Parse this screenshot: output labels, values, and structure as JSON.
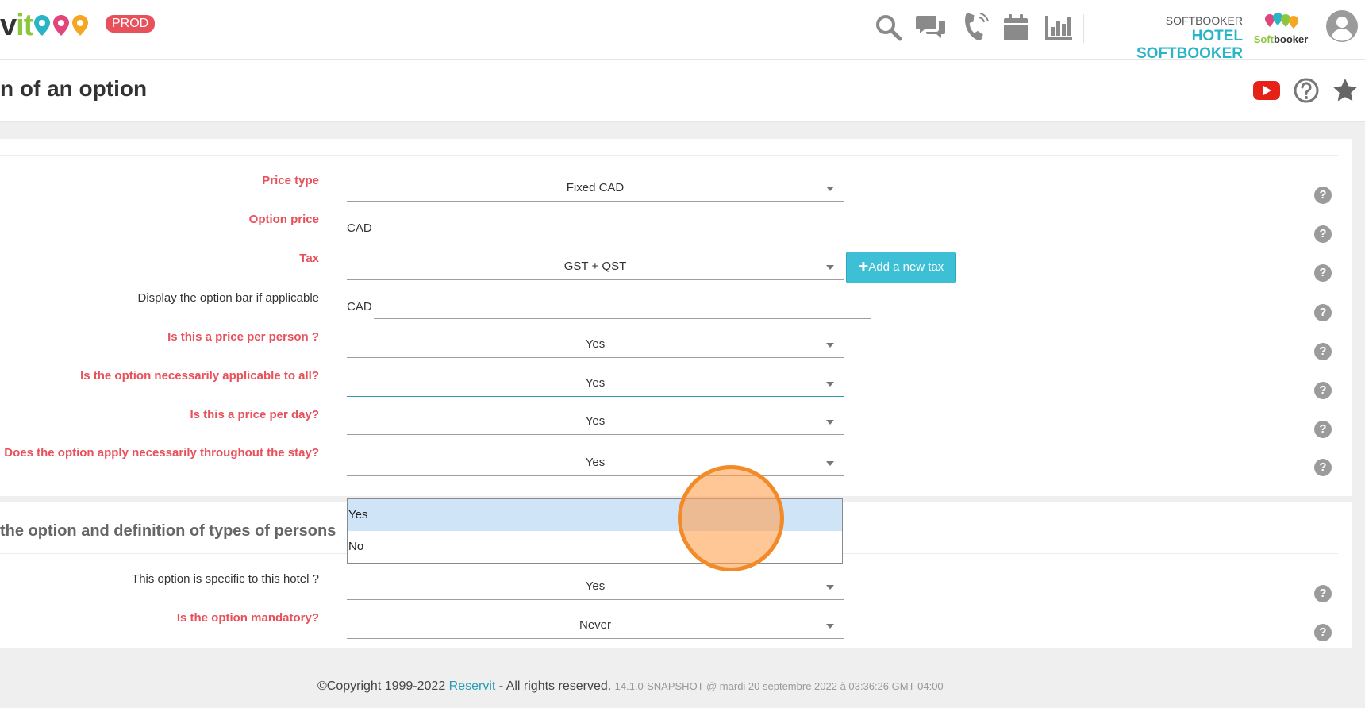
{
  "topbar": {
    "logo_prefix": "v",
    "logo_highlight": "it",
    "env_badge": "PROD",
    "icons": [
      "search-icon",
      "chat-icon",
      "phone-icon",
      "calendar-icon",
      "chart-icon"
    ],
    "company_small": "SOFTBOOKER",
    "company_big": "HOTEL SOFTBOOKER",
    "partner_logo_a": "Soft",
    "partner_logo_b": "booker"
  },
  "page": {
    "title": "n of an option",
    "actions": [
      "youtube-icon",
      "help-circle-icon",
      "star-icon"
    ]
  },
  "form": {
    "price_type": {
      "label": "Price type",
      "value": "Fixed CAD"
    },
    "option_price": {
      "label": "Option price",
      "prefix": "CAD"
    },
    "tax": {
      "label": "Tax",
      "value": "GST + QST",
      "add_button": "Add a new tax"
    },
    "option_bar": {
      "label": "Display the option bar if applicable",
      "prefix": "CAD"
    },
    "per_person": {
      "label": "Is this a price per person ?",
      "value": "Yes"
    },
    "applicable_all": {
      "label": "Is the option necessarily applicable to all?",
      "value": "Yes"
    },
    "per_day": {
      "label": "Is this a price per day?",
      "value": "Yes"
    },
    "whole_stay": {
      "label": "Does the option apply necessarily throughout the stay?",
      "value": "Yes"
    }
  },
  "section2": {
    "title": "the option and definition of types of persons",
    "specific_hotel": {
      "label": "This option is specific to this hotel ?",
      "value": "Yes"
    },
    "mandatory": {
      "label": "Is the option mandatory?",
      "value": "Never"
    }
  },
  "dropdown": {
    "options": [
      "Yes",
      "No"
    ],
    "selected": "Yes"
  },
  "help_symbol": "?",
  "footer": {
    "copyright": "©Copyright 1999-2022 ",
    "brand": "Reservit",
    "rights": " - All rights reserved. ",
    "version": "14.1.0-SNAPSHOT @ mardi 20 septembre 2022 à 03:36:26 GMT-04:00"
  },
  "colors": {
    "required_label": "#e8505b",
    "accent": "#2ab4c8",
    "button": "#3dbfd6",
    "dropdown_selected": "#cfe4f7",
    "click_marker": "#f28a28"
  }
}
